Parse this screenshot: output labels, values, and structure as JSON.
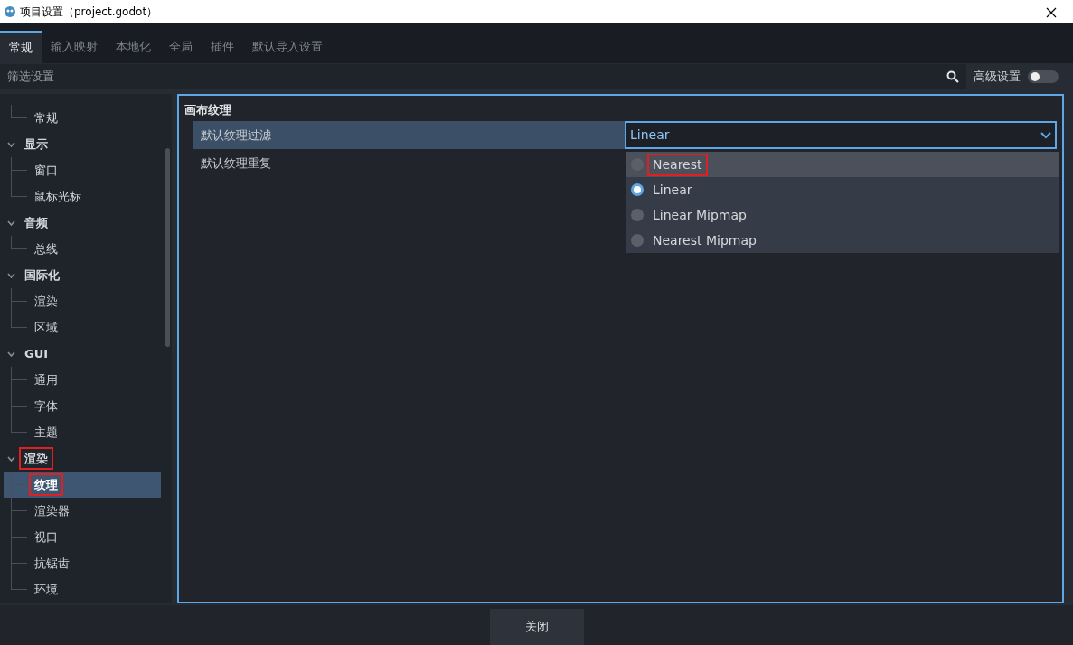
{
  "window": {
    "title": "项目设置（project.godot）"
  },
  "tabs": [
    {
      "label": "常规",
      "selected": true
    },
    {
      "label": "输入映射",
      "selected": false
    },
    {
      "label": "本地化",
      "selected": false
    },
    {
      "label": "全局",
      "selected": false
    },
    {
      "label": "插件",
      "selected": false
    },
    {
      "label": "默认导入设置",
      "selected": false
    }
  ],
  "filter": {
    "placeholder": "筛选设置"
  },
  "advanced": {
    "label": "高级设置",
    "on": false
  },
  "tree": [
    {
      "children": [
        {
          "label": "常规",
          "selected": false,
          "highlighted": false
        }
      ]
    },
    {
      "label": "显示",
      "expanded": true,
      "highlighted": false,
      "children": [
        {
          "label": "窗口",
          "selected": false,
          "highlighted": false
        },
        {
          "label": "鼠标光标",
          "selected": false,
          "highlighted": false
        }
      ]
    },
    {
      "label": "音频",
      "expanded": true,
      "highlighted": false,
      "children": [
        {
          "label": "总线",
          "selected": false,
          "highlighted": false
        }
      ]
    },
    {
      "label": "国际化",
      "expanded": true,
      "highlighted": false,
      "children": [
        {
          "label": "渲染",
          "selected": false,
          "highlighted": false
        },
        {
          "label": "区域",
          "selected": false,
          "highlighted": false
        }
      ]
    },
    {
      "label": "GUI",
      "expanded": true,
      "highlighted": false,
      "children": [
        {
          "label": "通用",
          "selected": false,
          "highlighted": false
        },
        {
          "label": "字体",
          "selected": false,
          "highlighted": false
        },
        {
          "label": "主题",
          "selected": false,
          "highlighted": false
        }
      ]
    },
    {
      "label": "渲染",
      "expanded": true,
      "highlighted": true,
      "children": [
        {
          "label": "纹理",
          "selected": true,
          "highlighted": true
        },
        {
          "label": "渲染器",
          "selected": false,
          "highlighted": false
        },
        {
          "label": "视口",
          "selected": false,
          "highlighted": false
        },
        {
          "label": "抗锯齿",
          "selected": false,
          "highlighted": false
        },
        {
          "label": "环境",
          "selected": false,
          "highlighted": false
        }
      ]
    }
  ],
  "section": {
    "title": "画布纹理",
    "properties": [
      {
        "label": "默认纹理过滤",
        "selected": true,
        "value": "Linear"
      },
      {
        "label": "默认纹理重复",
        "selected": false
      }
    ]
  },
  "dropdown": {
    "options": [
      {
        "label": "Nearest",
        "selected": false,
        "hovered": true,
        "highlighted": true
      },
      {
        "label": "Linear",
        "selected": true,
        "hovered": false,
        "highlighted": false
      },
      {
        "label": "Linear Mipmap",
        "selected": false,
        "hovered": false,
        "highlighted": false
      },
      {
        "label": "Nearest Mipmap",
        "selected": false,
        "hovered": false,
        "highlighted": false
      }
    ]
  },
  "footer": {
    "close": "关闭"
  }
}
